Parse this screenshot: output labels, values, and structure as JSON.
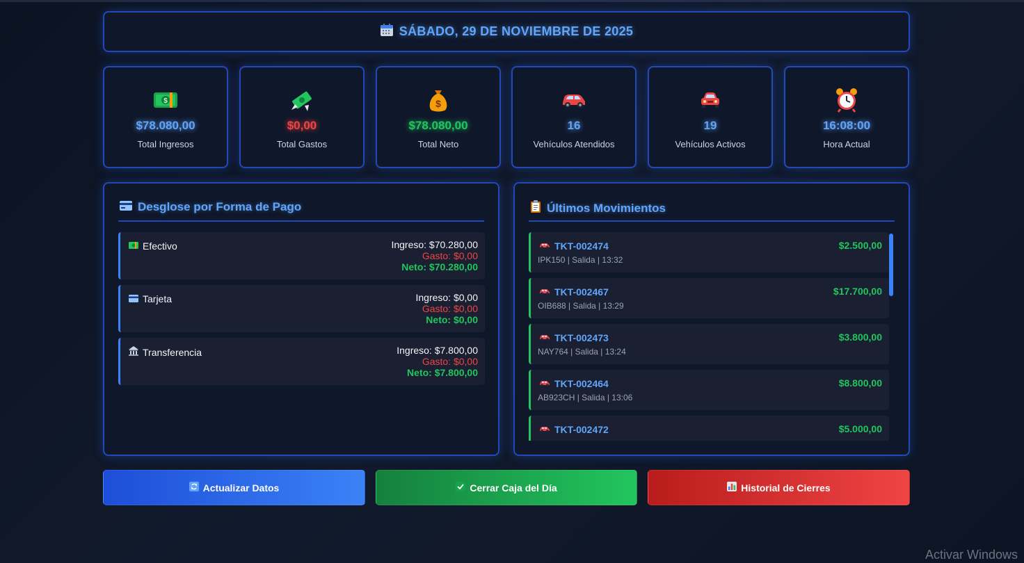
{
  "header": {
    "date": "SÁBADO, 29 DE NOVIEMBRE DE 2025",
    "icon": "calendar-icon"
  },
  "stats": [
    {
      "icon": "money-bill-icon",
      "value": "$78.080,00",
      "label": "Total Ingresos",
      "color": "#60a5fa"
    },
    {
      "icon": "money-wings-icon",
      "value": "$0,00",
      "label": "Total Gastos",
      "color": "#ef4444"
    },
    {
      "icon": "money-bag-icon",
      "value": "$78.080,00",
      "label": "Total Neto",
      "color": "#22c55e"
    },
    {
      "icon": "car-icon",
      "value": "16",
      "label": "Vehículos Atendidos",
      "color": "#60a5fa"
    },
    {
      "icon": "car-front-icon",
      "value": "19",
      "label": "Vehículos Activos",
      "color": "#60a5fa"
    },
    {
      "icon": "alarm-clock-icon",
      "value": "16:08:00",
      "label": "Hora Actual",
      "color": "#60a5fa"
    }
  ],
  "payments": {
    "title": "Desglose por Forma de Pago",
    "rows": [
      {
        "name": "Efectivo",
        "icon": "cash-icon",
        "ingreso": "Ingreso: $70.280,00",
        "gasto": "Gasto: $0,00",
        "neto": "Neto: $70.280,00"
      },
      {
        "name": "Tarjeta",
        "icon": "card-icon",
        "ingreso": "Ingreso: $0,00",
        "gasto": "Gasto: $0,00",
        "neto": "Neto: $0,00"
      },
      {
        "name": "Transferencia",
        "icon": "bank-icon",
        "ingreso": "Ingreso: $7.800,00",
        "gasto": "Gasto: $0,00",
        "neto": "Neto: $7.800,00"
      }
    ]
  },
  "movements": {
    "title": "Últimos Movimientos",
    "items": [
      {
        "ticket": "TKT-002474",
        "detail": "IPK150 | Salida | 13:32",
        "amount": "$2.500,00"
      },
      {
        "ticket": "TKT-002467",
        "detail": "OIB688 | Salida | 13:29",
        "amount": "$17.700,00"
      },
      {
        "ticket": "TKT-002473",
        "detail": "NAY764 | Salida | 13:24",
        "amount": "$3.800,00"
      },
      {
        "ticket": "TKT-002464",
        "detail": "AB923CH | Salida | 13:06",
        "amount": "$8.800,00"
      },
      {
        "ticket": "TKT-002472",
        "detail": "",
        "amount": "$5.000,00"
      }
    ]
  },
  "buttons": {
    "refresh": "Actualizar Datos",
    "close": "Cerrar Caja del Día",
    "history": "Historial de Cierres"
  },
  "watermark": "Activar Windows"
}
